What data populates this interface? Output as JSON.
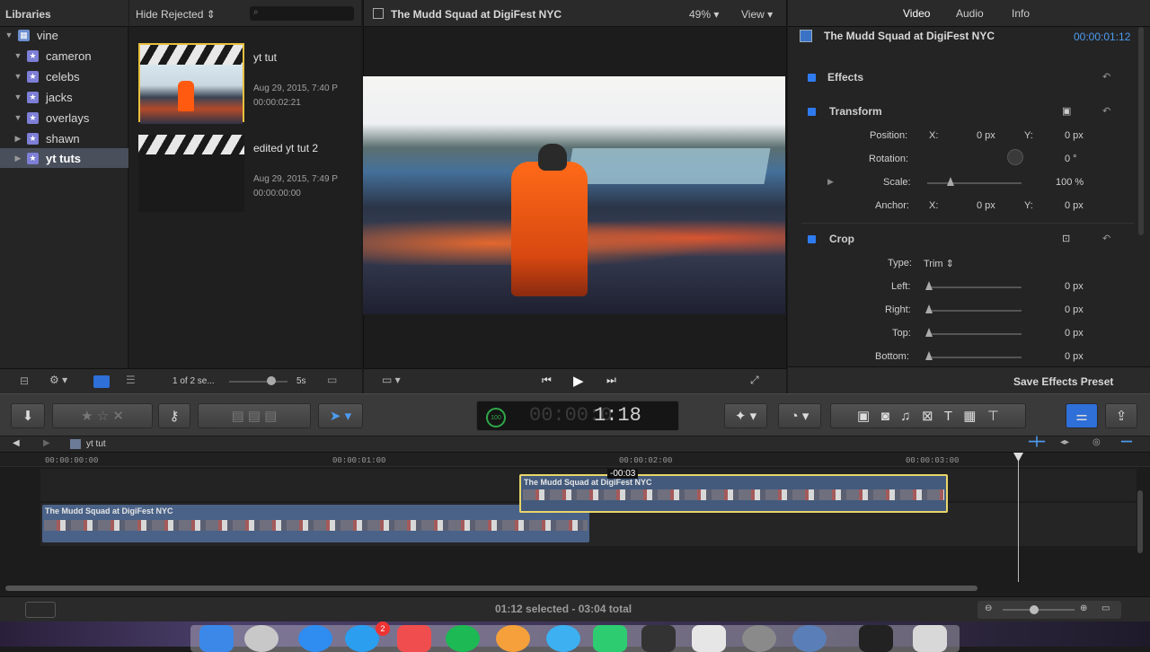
{
  "libraries": {
    "title": "Libraries",
    "items": [
      {
        "label": "vine",
        "selected": false
      },
      {
        "label": "cameron",
        "selected": false
      },
      {
        "label": "celebs",
        "selected": false
      },
      {
        "label": "jacks",
        "selected": false
      },
      {
        "label": "overlays",
        "selected": false
      },
      {
        "label": "shawn",
        "selected": false
      },
      {
        "label": "yt tuts",
        "selected": true
      }
    ]
  },
  "browser": {
    "filter": "Hide Rejected",
    "clips": [
      {
        "name": "yt tut",
        "date": "Aug 29, 2015, 7:40 P",
        "duration": "00:00:02:21"
      },
      {
        "name": "edited yt tut 2",
        "date": "Aug 29, 2015, 7:49 P",
        "duration": "00:00:00:00"
      }
    ],
    "count": "1 of 2 se...",
    "zoom": "5s"
  },
  "viewer": {
    "title": "The Mudd Squad at DigiFest NYC",
    "zoom": "49%",
    "view": "View"
  },
  "inspector": {
    "tabs": [
      "Video",
      "Audio",
      "Info"
    ],
    "clip_name": "The Mudd Squad at DigiFest NYC",
    "clip_time": "00:00:01:12",
    "effects": "Effects",
    "transform": "Transform",
    "position_label": "Position:",
    "x_label": "X:",
    "y_label": "Y:",
    "pos_x": "0 px",
    "pos_y": "0 px",
    "rotation_label": "Rotation:",
    "rotation": "0 °",
    "scale_label": "Scale:",
    "scale": "100 %",
    "anchor_label": "Anchor:",
    "anchor_x": "0 px",
    "anchor_y": "0 px",
    "crop": "Crop",
    "type_label": "Type:",
    "type_value": "Trim",
    "left_label": "Left:",
    "left": "0 px",
    "right_label": "Right:",
    "right": "0 px",
    "top_label": "Top:",
    "top": "0 px",
    "bottom_label": "Bottom:",
    "bottom": "0 px",
    "save_preset": "Save Effects Preset"
  },
  "toolbar": {
    "timecode": "1:18",
    "dial": "100"
  },
  "timeline": {
    "project": "yt tut",
    "ruler": [
      "00:00:00:00",
      "00:00:01:00",
      "00:00:02:00",
      "00:00:03:00"
    ],
    "clip_main": "The Mudd Squad at DigiFest NYC",
    "clip_connected": "The Mudd Squad at DigiFest NYC",
    "drag_offset": "-00:03"
  },
  "status": {
    "summary": "01:12 selected - 03:04 total"
  },
  "dock": {
    "badge": "2"
  }
}
